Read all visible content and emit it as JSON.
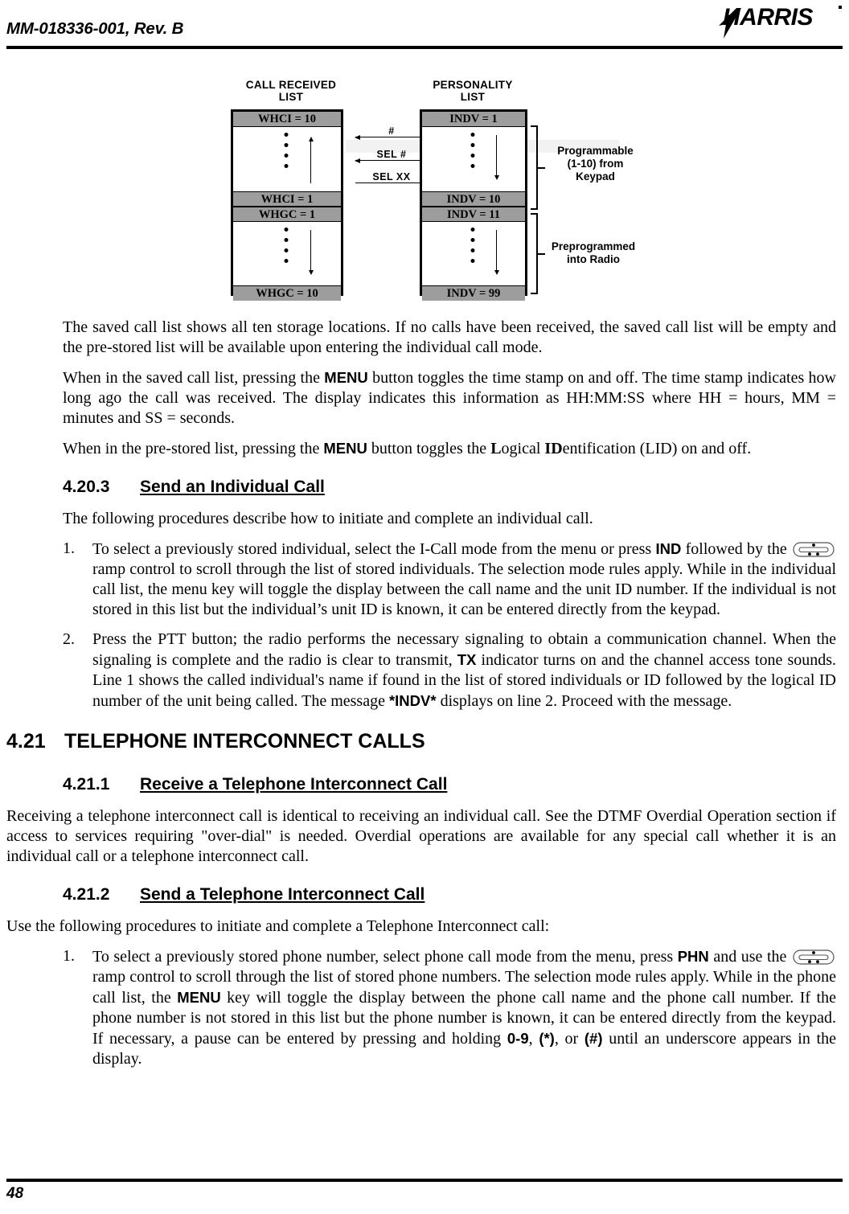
{
  "header": {
    "doc_id": "MM-018336-001,  Rev. B",
    "logo_text": "HARRIS",
    "logo_icon": "harris-lightning-logo"
  },
  "figure": {
    "left_list": {
      "title_line1": "CALL RECEIVED",
      "title_line2": "LIST",
      "segments": [
        {
          "label": "WHCI = 10",
          "type": "gray"
        },
        {
          "label": "",
          "type": "body",
          "arrow": "up"
        },
        {
          "label": "WHCI = 1",
          "type": "gray"
        },
        {
          "label": "WHGC = 1",
          "type": "gray"
        },
        {
          "label": "",
          "type": "body",
          "arrow": "down"
        },
        {
          "label": "WHGC = 10",
          "type": "gray"
        }
      ]
    },
    "right_list": {
      "title_line1": "PERSONALITY",
      "title_line2": "LIST",
      "segments": [
        {
          "label": "INDV = 1",
          "type": "gray"
        },
        {
          "label": "",
          "type": "body",
          "arrow": "down"
        },
        {
          "label": "INDV = 10",
          "type": "gray"
        },
        {
          "label": "INDV = 11",
          "type": "gray"
        },
        {
          "label": "",
          "type": "body",
          "arrow": "down"
        },
        {
          "label": "INDV = 99",
          "type": "gray"
        }
      ]
    },
    "arrows": [
      {
        "label": "#",
        "direction": "both"
      },
      {
        "label": "SEL #",
        "direction": "left"
      },
      {
        "label": "SEL XX",
        "direction": "right"
      }
    ],
    "brackets": [
      {
        "line1": "Programmable",
        "line2": "(1-10) from",
        "line3": "Keypad"
      },
      {
        "line1": "Preprogrammed",
        "line2": "into Radio",
        "line3": ""
      }
    ]
  },
  "content": {
    "para1": "The saved call list shows all ten storage locations. If no calls have been received, the saved call list will be empty and the pre-stored list will be available upon entering the individual call mode.",
    "para2_a": "When in the saved call list, pressing the ",
    "para2_menu": "MENU",
    "para2_b": " button toggles the time stamp on and off. The time stamp indicates how long ago the call was received. The display indicates this information as HH:MM:SS where HH = hours, MM = minutes and SS = seconds.",
    "para3_a": "When in the pre-stored list, pressing the ",
    "para3_menu": "MENU",
    "para3_b": " button toggles the ",
    "para3_l": "L",
    "para3_c": "ogical ",
    "para3_id": "ID",
    "para3_d": "entification (LID) on and off.",
    "h_4_20_3_num": "4.20.3",
    "h_4_20_3_title": "Send an Individual Call",
    "para4": "The following procedures describe how to initiate and complete an individual call.",
    "step1_num": "1.",
    "step1_a": "To select a previously stored individual, select the I-Call mode from the menu or press ",
    "step1_ind": "IND",
    "step1_b": " followed by the ",
    "step1_c": " ramp control to scroll through the list of stored individuals. The selection mode rules apply. While in the individual call list, the menu key will toggle the display between the call name and the unit ID number. If the individual is not stored in this list but the individual’s unit ID is known, it can be entered directly from the keypad.",
    "step2_num": "2.",
    "step2_a": "Press the PTT button; the radio performs the necessary signaling to obtain a communication channel. When the signaling is complete and the radio is clear to transmit, ",
    "step2_tx": "TX",
    "step2_b": " indicator turns on and the channel access tone sounds. Line 1 shows the called individual's name if found in the list of stored individuals or ID followed by the logical ID number of the unit being called. The message ",
    "step2_indv": "*INDV*",
    "step2_c": " displays on line 2. Proceed with the message.",
    "h_4_21_num": "4.21",
    "h_4_21_title": "TELEPHONE INTERCONNECT CALLS",
    "h_4_21_1_num": "4.21.1",
    "h_4_21_1_title": "Receive a Telephone Interconnect Call",
    "para5": "Receiving a telephone interconnect call is identical to receiving an individual call. See the DTMF Overdial Operation section if access to services requiring \"over-dial\" is needed. Overdial operations are available for any special call whether it is an individual call or a telephone interconnect call.",
    "h_4_21_2_num": "4.21.2",
    "h_4_21_2_title": "Send a Telephone Interconnect Call",
    "para6": "Use the following procedures to initiate and complete a Telephone Interconnect call:",
    "step3_num": "1.",
    "step3_a": "To select a previously stored phone number, select phone call mode from the menu, press ",
    "step3_phn": "PHN",
    "step3_b": " and use the ",
    "step3_c": " ramp control to scroll through the list of stored phone numbers. The selection mode rules apply. While in the phone call list, the ",
    "step3_menu": "MENU",
    "step3_d": " key will toggle the display between the phone call name and the phone call number. If the phone number is not stored in this list but the phone number is known, it can be entered directly from the keypad. If necessary, a pause can be entered by pressing and holding ",
    "step3_09": "0-9",
    "step3_e": ", ",
    "step3_star": "(*)",
    "step3_f": ", or ",
    "step3_hash": "(#)",
    "step3_g": " until an underscore appears in the display."
  },
  "footer": {
    "page_number": "48"
  }
}
